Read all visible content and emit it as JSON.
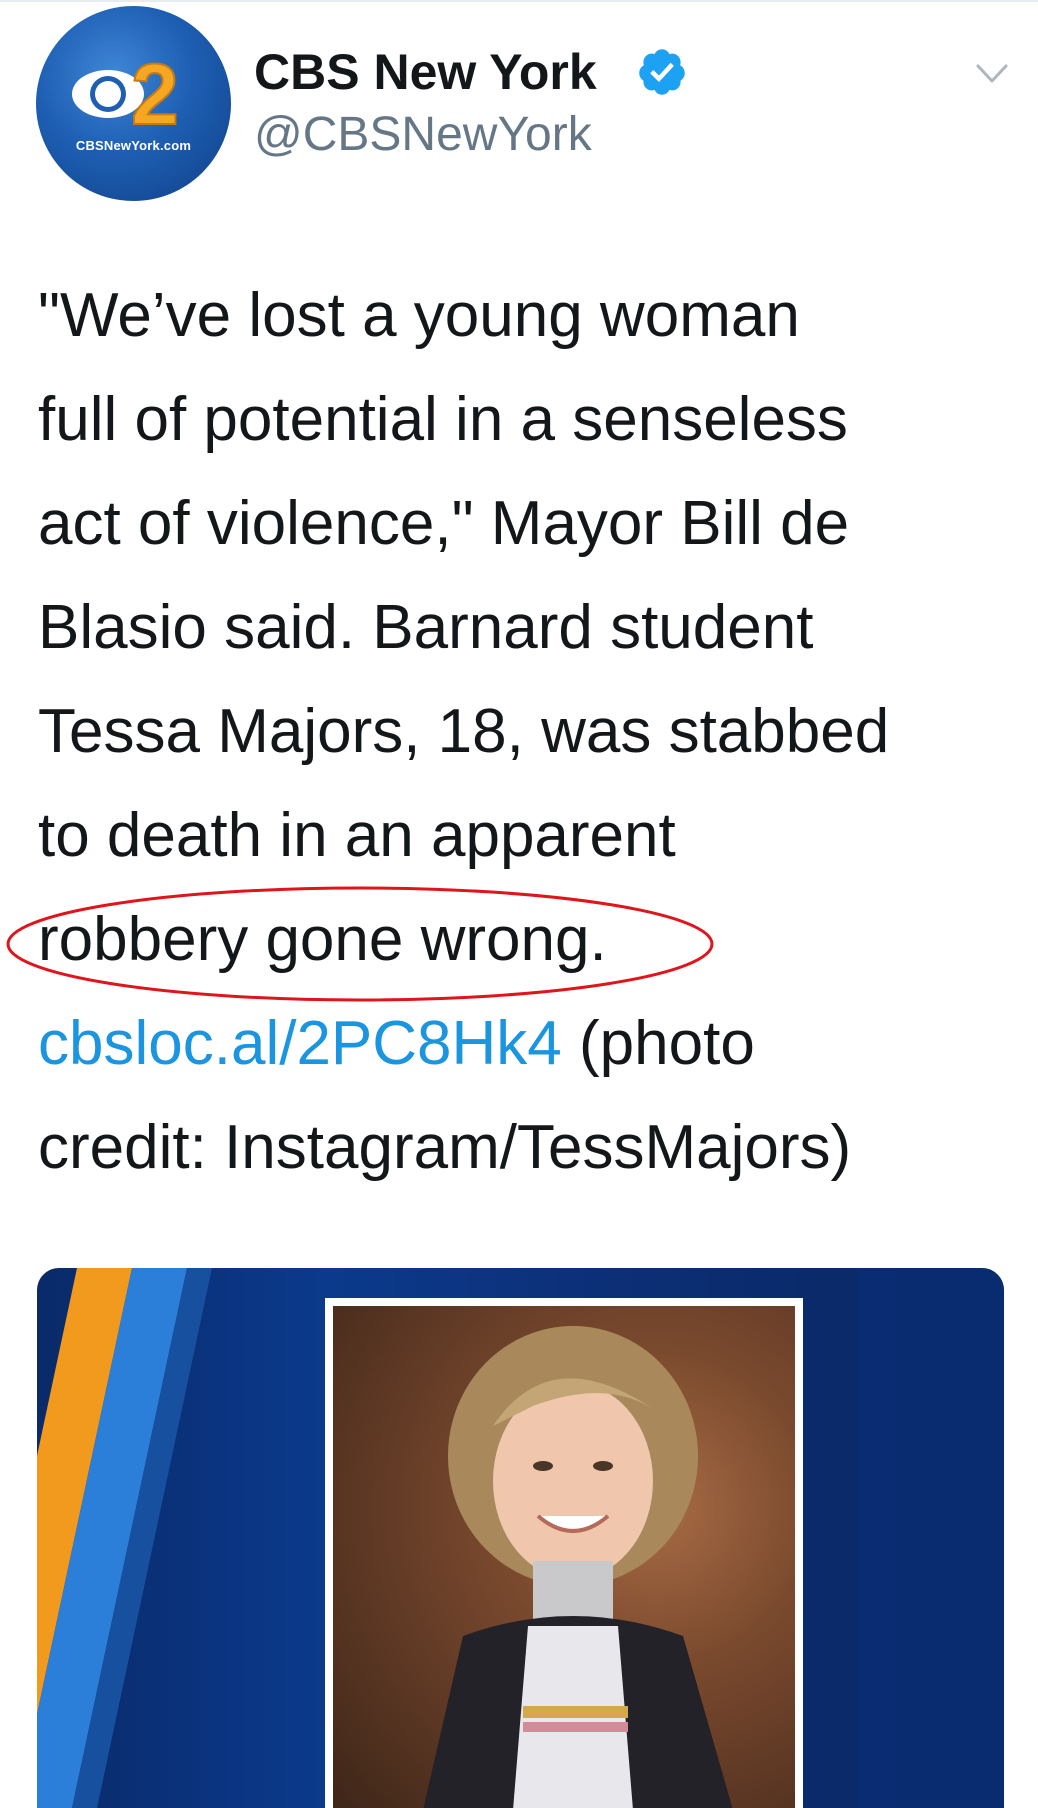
{
  "tweet": {
    "author": {
      "display_name": "CBS New York",
      "handle": "@CBSNewYork",
      "verified": true,
      "avatar_caption": "CBSNewYork.com"
    },
    "text_lines": [
      "\"We’ve lost a young woman",
      "full of potential in a senseless",
      "act of violence,\" Mayor Bill de",
      "Blasio said. Barnard student",
      "Tessa Majors, 18, was stabbed",
      "to death in an apparent",
      "robbery gone wrong."
    ],
    "link_text": "cbsloc.al/2PC8Hk4",
    "link_suffix": " (photo",
    "last_line": "credit: Instagram/TessMajors)",
    "colors": {
      "link": "#1b95e0",
      "verified": "#1da1f2",
      "annotation": "#e0151b"
    }
  },
  "icons": [
    "verified-badge-icon",
    "chevron-down-icon",
    "cbs-eye-logo-icon"
  ]
}
